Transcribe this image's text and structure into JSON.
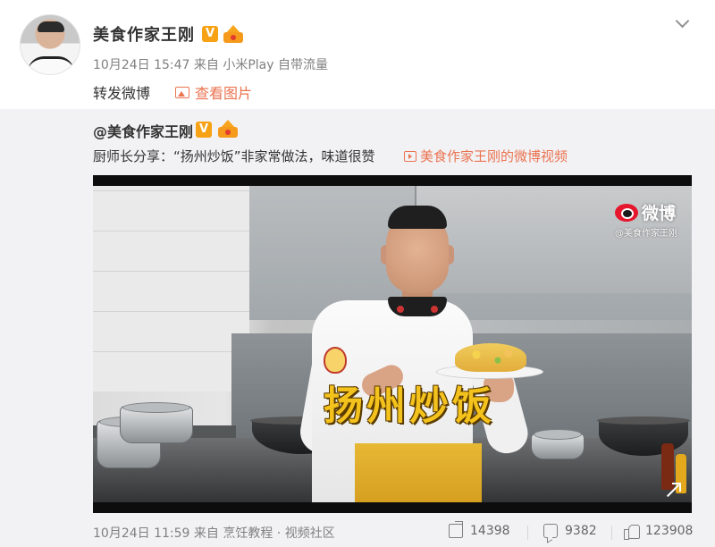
{
  "post": {
    "author": "美食作家王刚",
    "verified_badge": "V",
    "time": "10月24日 15:47",
    "source_prefix": "来自",
    "source": "小米Play 自带流量",
    "text": "转发微博",
    "view_image_label": "查看图片"
  },
  "repost": {
    "author": "@美食作家王刚",
    "verified_badge": "V",
    "text": "厨师长分享：“扬州炒饭”非家常做法，味道很赞",
    "video_link": "美食作家王刚的微博视频",
    "video": {
      "caption": "扬州炒饭",
      "watermark_logo": "微博",
      "watermark_handle": "@美食作家王刚"
    },
    "time": "10月24日 11:59",
    "source_prefix": "来自",
    "source": "烹饪教程 · 视频社区",
    "stats": {
      "shares": "14398",
      "comments": "9382",
      "likes": "123908"
    }
  },
  "icons": {
    "menu": "chevron-down-icon",
    "view_image": "image-icon",
    "video_link": "video-play-icon",
    "share": "share-icon",
    "comment": "comment-icon",
    "like": "like-icon"
  },
  "colors": {
    "link": "#eb7350",
    "repost_bg": "#f2f2f5",
    "badge": "#f6a214",
    "caption": "#f4c21c"
  }
}
